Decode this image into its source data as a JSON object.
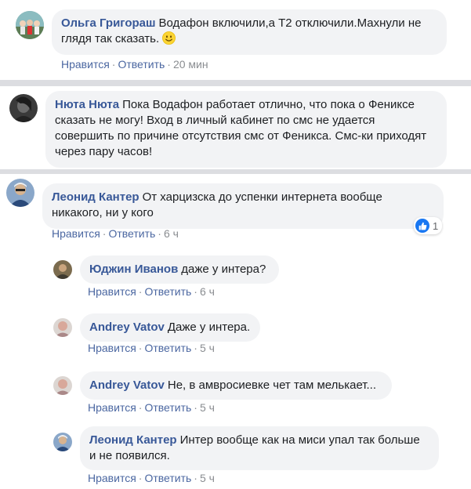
{
  "actions": {
    "like": "Нравится",
    "reply": "Ответить",
    "separator": "·"
  },
  "comments": [
    {
      "author": "Ольга Григораш",
      "text": "Водафон включили,а Т2 отключили.Махнули не глядя так сказать.",
      "emoji": "smile-emoji",
      "time": "20 мин"
    },
    {
      "author": "Нюта Нюта",
      "text": "Пока Водафон работает отлично, что пока о Фениксе сказать не могу! Вход в личный кабинет по смс не удается совершить по причине отсутствия смс от Феникса. Смс-ки приходят через пару часов!"
    },
    {
      "author": "Леонид Кантер",
      "text": "От харцизска до успенки интернета вообще никакого, ни у кого",
      "time": "6 ч",
      "reactions": {
        "icon": "like-icon",
        "count": "1"
      },
      "replies": [
        {
          "author": "Юджин Иванов",
          "text": "даже у интера?",
          "time": "6 ч"
        },
        {
          "author": "Andrey Vatov",
          "text": "Даже у интера.",
          "time": "5 ч"
        },
        {
          "author": "Andrey Vatov",
          "text": "Не, в амвросиевке чет там мелькает...",
          "time": "5 ч"
        },
        {
          "author": "Леонид Кантер",
          "text": "Интер вообще как на миси упал так больше и не появился.",
          "time": "5 ч"
        }
      ]
    }
  ],
  "colors": {
    "author": "#385898",
    "link": "#4b67a1",
    "bubble": "#f2f3f5",
    "meta": "#8a8d91",
    "like": "#1877f2"
  }
}
